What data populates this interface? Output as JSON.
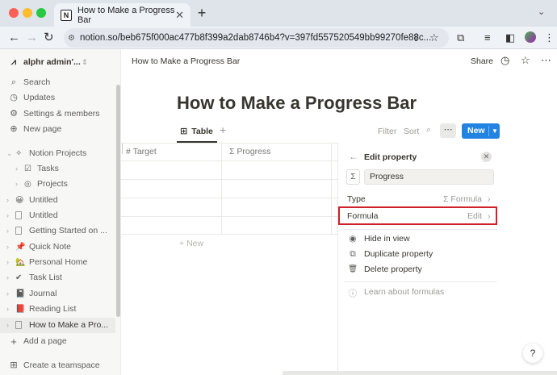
{
  "browser": {
    "tab_title": "How to Make a Progress Bar",
    "tab_icon": "N",
    "url": "notion.so/beb675f000ac477b8f399a2dab8746b4?v=397fd557520549bb99270fe88c..."
  },
  "workspace": {
    "name": "alphr admin'..."
  },
  "sidebar": {
    "nav": [
      {
        "label": "Search",
        "icon": "⌕"
      },
      {
        "label": "Updates",
        "icon": "◷"
      },
      {
        "label": "Settings & members",
        "icon": "⚙"
      },
      {
        "label": "New page",
        "icon": "⊕"
      }
    ],
    "pages": [
      {
        "label": "Notion Projects",
        "icon": "✧",
        "chev": "⌄"
      },
      {
        "label": "Tasks",
        "icon": "☑",
        "chev": "›"
      },
      {
        "label": "Projects",
        "icon": "◎",
        "chev": "›"
      },
      {
        "label": "Untitled",
        "icon": "😀",
        "chev": "›"
      },
      {
        "label": "Untitled",
        "icon": "doc",
        "chev": "›"
      },
      {
        "label": "Getting Started on ...",
        "icon": "doc",
        "chev": "›"
      },
      {
        "label": "Quick Note",
        "icon": "📌",
        "chev": "›"
      },
      {
        "label": "Personal Home",
        "icon": "🏡",
        "chev": "›"
      },
      {
        "label": "Task List",
        "icon": "✔",
        "chev": "›"
      },
      {
        "label": "Journal",
        "icon": "📓",
        "chev": "›"
      },
      {
        "label": "Reading List",
        "icon": "📕",
        "chev": "›"
      },
      {
        "label": "How to Make a Pro...",
        "icon": "doc",
        "chev": "›"
      }
    ],
    "add_page": "Add a page",
    "create_teamspace": "Create a teamspace"
  },
  "topbar": {
    "breadcrumb": "How to Make a Progress Bar",
    "share": "Share"
  },
  "page": {
    "title": "How to Make a Progress Bar"
  },
  "views": {
    "active": "Table",
    "filter": "Filter",
    "sort": "Sort",
    "new": "New"
  },
  "table": {
    "columns": [
      {
        "icon": "#",
        "label": "Target"
      },
      {
        "icon": "Σ",
        "label": "Progress"
      }
    ],
    "new_row": "New"
  },
  "panel": {
    "title": "Edit property",
    "prop_icon": "Σ",
    "prop_name": "Progress",
    "type_label": "Type",
    "type_value": "Σ Formula",
    "formula_label": "Formula",
    "formula_value": "Edit",
    "actions": [
      {
        "label": "Hide in view",
        "icon": "◉"
      },
      {
        "label": "Duplicate property",
        "icon": "⧉"
      },
      {
        "label": "Delete property",
        "icon": "🗑"
      }
    ],
    "learn": "Learn about formulas"
  },
  "colors": {
    "accent": "#2383e2",
    "highlight": "#d0202a"
  }
}
